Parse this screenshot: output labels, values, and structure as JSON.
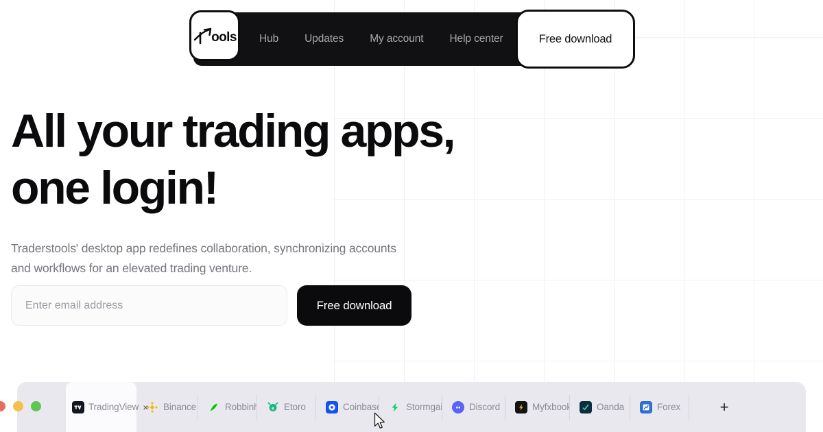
{
  "navbar": {
    "logo": {
      "name": "traderstools-logo",
      "text": "ools",
      "icon": "arrow-up-right-icon"
    },
    "links": [
      {
        "label": "Hub"
      },
      {
        "label": "Updates"
      },
      {
        "label": "My account"
      },
      {
        "label": "Help center"
      }
    ],
    "cta_label": "Free download",
    "background_color": "#111113"
  },
  "hero": {
    "headline_line1": "All your trading apps,",
    "headline_line2": "one login!",
    "subtitle": "Traderstools' desktop app redefines collaboration, synchronizing accounts and workflows for an elevated trading venture."
  },
  "signup": {
    "email_placeholder": "Enter email address",
    "email_value": "",
    "button_label": "Free download",
    "button_color": "#0b0b0d"
  },
  "app_window": {
    "traffic_lights": [
      {
        "name": "close",
        "color": "#ed6a5f"
      },
      {
        "name": "minimize",
        "color": "#f5bf4f"
      },
      {
        "name": "zoom",
        "color": "#61c554"
      }
    ],
    "active_tab": {
      "label": "TradingView",
      "icon": "tradingview-icon",
      "icon_color": "#131722",
      "close_label": "×"
    },
    "tabs": [
      {
        "label": "Binance",
        "icon": "binance-icon",
        "icon_color": "#f0b90b"
      },
      {
        "label": "Robbinhood",
        "icon": "robinhood-icon",
        "icon_color": "#00c805"
      },
      {
        "label": "Etoro",
        "icon": "etoro-icon",
        "icon_color": "#13b87b"
      },
      {
        "label": "Coinbase",
        "icon": "coinbase-icon",
        "icon_color": "#1652f0"
      },
      {
        "label": "Stormgain",
        "icon": "stormgain-icon",
        "icon_color": "#00d26a"
      },
      {
        "label": "Discord",
        "icon": "discord-icon",
        "icon_color": "#5865f2"
      },
      {
        "label": "Myfxbook",
        "icon": "myfxbook-icon",
        "icon_color": "#f5c518"
      },
      {
        "label": "Oanda",
        "icon": "oanda-icon",
        "icon_color": "#0d2c40"
      },
      {
        "label": "Forex",
        "icon": "forex-icon",
        "icon_color": "#2f6fd0"
      }
    ],
    "add_tab_label": "+"
  }
}
